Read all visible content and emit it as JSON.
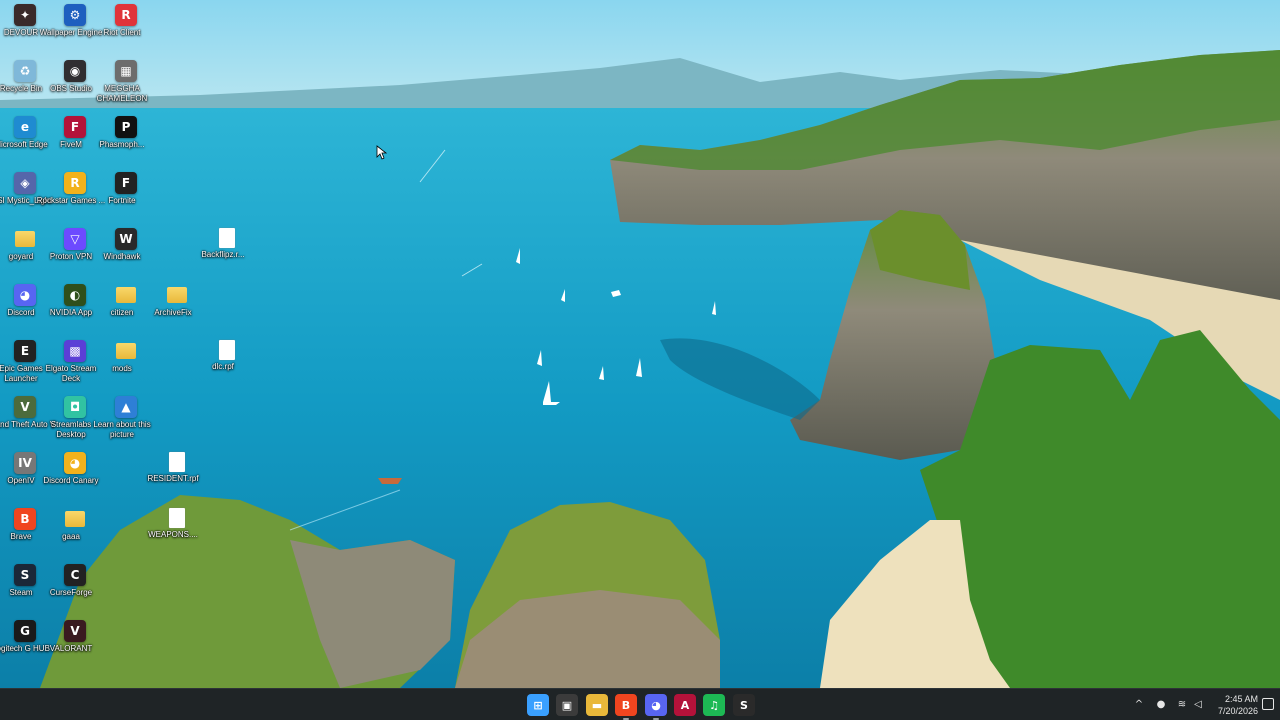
{
  "desktop": {
    "icons": [
      {
        "label": "DEVOUR",
        "icon": "devour-icon",
        "color": "#3a2a2a",
        "glyph": "✦"
      },
      {
        "label": "Wallpaper Engine",
        "icon": "wallpaper-engine-icon",
        "color": "#1e5fbf",
        "glyph": "⚙"
      },
      {
        "label": "Riot Client",
        "icon": "riot-client-icon",
        "color": "#e0343a",
        "glyph": "R"
      },
      {
        "label": "Recycle Bin",
        "icon": "recycle-bin-icon",
        "color": "#7fb8d9",
        "glyph": "♻"
      },
      {
        "label": "OBS Studio",
        "icon": "obs-studio-icon",
        "color": "#302e31",
        "glyph": "◉"
      },
      {
        "label": "MEGGHA CHAMELEON",
        "icon": "megga-chameleon-icon",
        "color": "#6d6d6d",
        "glyph": "▦"
      },
      {
        "label": "Microsoft Edge",
        "icon": "edge-icon",
        "color": "#1f8bd1",
        "glyph": "e"
      },
      {
        "label": "FiveM",
        "icon": "fivem-icon",
        "color": "#b3123a",
        "glyph": "F"
      },
      {
        "label": "Phasmoph...",
        "icon": "phasmophobia-icon",
        "color": "#111111",
        "glyph": "P"
      },
      {
        "label": "MSI Mystic_Light",
        "icon": "msi-mystic-light-icon",
        "color": "#5566aa",
        "glyph": "◈"
      },
      {
        "label": "Rockstar Games ...",
        "icon": "rockstar-games-icon",
        "color": "#f2b21b",
        "glyph": "R"
      },
      {
        "label": "Fortnite",
        "icon": "fortnite-icon",
        "color": "#222222",
        "glyph": "F"
      },
      {
        "label": "goyard",
        "icon": "folder-icon"
      },
      {
        "label": "Proton VPN",
        "icon": "proton-vpn-icon",
        "color": "#6d4aff",
        "glyph": "▽"
      },
      {
        "label": "Windhawk",
        "icon": "windhawk-icon",
        "color": "#2a2a2a",
        "glyph": "W"
      },
      {
        "label": "Backflipz.r...",
        "icon": "file-icon"
      },
      {
        "label": "Discord",
        "icon": "discord-icon",
        "color": "#5865f2",
        "glyph": "◕"
      },
      {
        "label": "NVIDIA App",
        "icon": "nvidia-app-icon",
        "color": "#2f4f1b",
        "glyph": "◐"
      },
      {
        "label": "citizen",
        "icon": "folder-icon"
      },
      {
        "label": "ArchiveFix",
        "icon": "folder-icon"
      },
      {
        "label": "Epic Games Launcher",
        "icon": "epic-games-icon",
        "color": "#222222",
        "glyph": "E"
      },
      {
        "label": "Elgato Stream Deck",
        "icon": "elgato-stream-deck-icon",
        "color": "#5b3fd6",
        "glyph": "▩"
      },
      {
        "label": "mods",
        "icon": "folder-icon"
      },
      {
        "label": "dlc.rpf",
        "icon": "file-icon"
      },
      {
        "label": "Grand Theft Auto V",
        "icon": "gta-v-icon",
        "color": "#4c6b3c",
        "glyph": "V"
      },
      {
        "label": "Streamlabs Desktop",
        "icon": "streamlabs-icon",
        "color": "#31c3a2",
        "glyph": "◘"
      },
      {
        "label": "Learn about this picture",
        "icon": "learn-picture-icon",
        "color": "#2e7fd6",
        "glyph": "▲"
      },
      {
        "label": "OpenIV",
        "icon": "openiv-icon",
        "color": "#777777",
        "glyph": "IV"
      },
      {
        "label": "Discord Canary",
        "icon": "discord-canary-icon",
        "color": "#f2b21b",
        "glyph": "◕"
      },
      {
        "label": "RESIDENT.rpf",
        "icon": "file-icon"
      },
      {
        "label": "Brave",
        "icon": "brave-icon",
        "color": "#f0451f",
        "glyph": "B"
      },
      {
        "label": "gaaa",
        "icon": "folder-icon"
      },
      {
        "label": "WEAPONS....",
        "icon": "file-icon"
      },
      {
        "label": "Steam",
        "icon": "steam-icon",
        "color": "#1b2838",
        "glyph": "S"
      },
      {
        "label": "CurseForge",
        "icon": "curseforge-icon",
        "color": "#222222",
        "glyph": "C"
      },
      {
        "label": "Logitech G HUB",
        "icon": "logitech-g-hub-icon",
        "color": "#1a1a1a",
        "glyph": "G"
      },
      {
        "label": "VALORANT",
        "icon": "valorant-icon",
        "color": "#3a1a20",
        "glyph": "V"
      }
    ]
  },
  "taskbar": {
    "apps": [
      {
        "icon": "start-icon",
        "color": "#3aa0ff",
        "glyph": "⊞"
      },
      {
        "icon": "microsoft-store-icon",
        "color": "#3b3b3b",
        "glyph": "▣"
      },
      {
        "icon": "file-explorer-icon",
        "color": "#e9b83a",
        "glyph": "▬"
      },
      {
        "icon": "brave-icon",
        "color": "#f0451f",
        "glyph": "B"
      },
      {
        "icon": "discord-icon",
        "color": "#5865f2",
        "glyph": "◕"
      },
      {
        "icon": "affinity-icon",
        "color": "#b3123a",
        "glyph": "A"
      },
      {
        "icon": "spotify-icon",
        "color": "#1db954",
        "glyph": "♫"
      },
      {
        "icon": "steam-icon",
        "color": "#2a2a2a",
        "glyph": "S"
      }
    ],
    "tray": [
      {
        "icon": "chevron-up-icon",
        "glyph": "^"
      },
      {
        "icon": "microphone-icon",
        "glyph": "●"
      },
      {
        "icon": "wifi-icon",
        "glyph": "≋"
      },
      {
        "icon": "volume-icon",
        "glyph": "◁"
      }
    ],
    "time": "2:45 AM",
    "date": "7/20/2026"
  }
}
